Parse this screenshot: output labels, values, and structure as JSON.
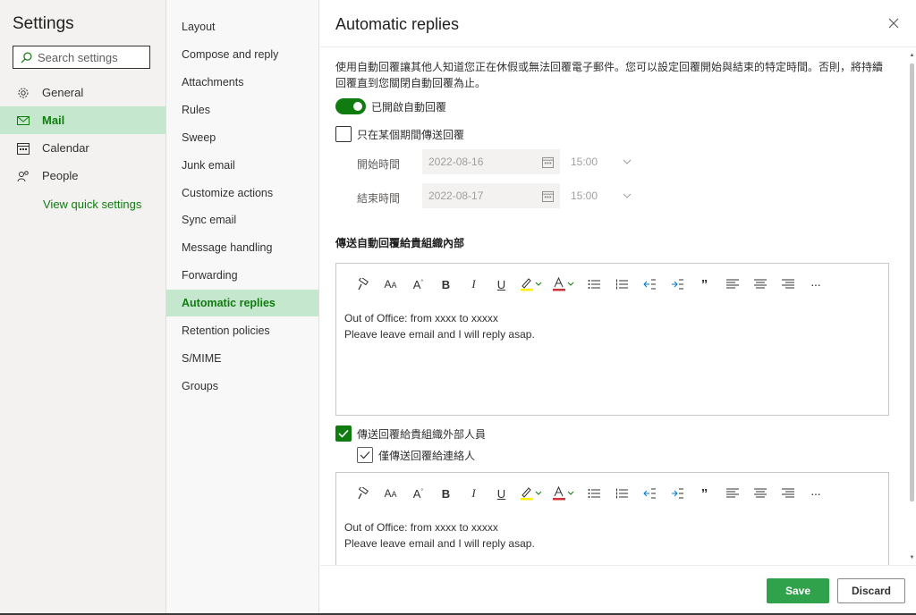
{
  "left_nav": {
    "title": "Settings",
    "search_placeholder": "Search settings",
    "items": [
      {
        "label": "General",
        "icon": "gear-icon"
      },
      {
        "label": "Mail",
        "icon": "mail-icon"
      },
      {
        "label": "Calendar",
        "icon": "calendar-icon"
      },
      {
        "label": "People",
        "icon": "people-icon"
      }
    ],
    "active": "Mail",
    "quick_settings": "View quick settings"
  },
  "mid_nav": {
    "items": [
      "Layout",
      "Compose and reply",
      "Attachments",
      "Rules",
      "Sweep",
      "Junk email",
      "Customize actions",
      "Sync email",
      "Message handling",
      "Forwarding",
      "Automatic replies",
      "Retention policies",
      "S/MIME",
      "Groups"
    ],
    "active": "Automatic replies"
  },
  "panel": {
    "title": "Automatic replies",
    "description": "使用自動回覆讓其他人知道您正在休假或無法回覆電子郵件。您可以設定回覆開始與結束的特定時間。否則，將持續回覆直到您關閉自動回覆為止。",
    "toggle_label": "已開啟自動回覆",
    "toggle_on": true,
    "period_label": "只在某個期間傳送回覆",
    "period_checked": false,
    "start_label": "開始時間",
    "start_date": "2022-08-16",
    "start_time": "15:00",
    "end_label": "結束時間",
    "end_date": "2022-08-17",
    "end_time": "15:00",
    "internal_title": "傳送自動回覆給貴組織內部",
    "internal_message": {
      "line1": "Out of Office: from xxxx to xxxxx",
      "line2": "Pleave leave email and I will reply asap."
    },
    "external_label": "傳送回覆給貴組織外部人員",
    "external_checked": true,
    "contacts_only_label": "僅傳送回覆給連絡人",
    "contacts_only_checked": true,
    "external_message": {
      "line1": "Out of Office: from xxxx to xxxxx",
      "line2": "Pleave leave email and I will reply asap."
    },
    "toolbar": {
      "bold": "B",
      "italic": "I",
      "underline": "U",
      "quote": "”",
      "more": "···",
      "font_size_glyph": "A",
      "font_size_glyph_small": "A",
      "grow_glyph": "A"
    }
  },
  "footer": {
    "save": "Save",
    "discard": "Discard"
  },
  "colors": {
    "accent": "#107c10",
    "active_bg": "#c5e7cd",
    "save_bg": "#31a24c"
  }
}
